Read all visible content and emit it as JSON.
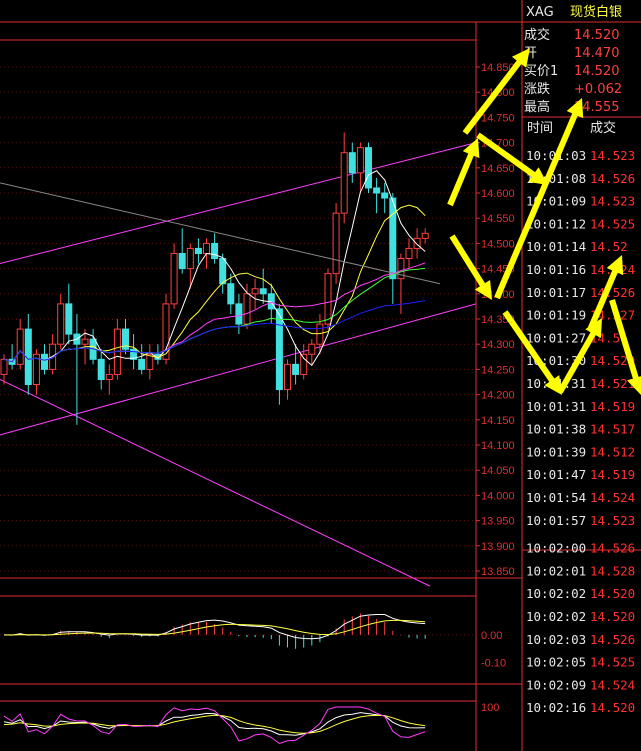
{
  "symbol": "XAG",
  "symbol_name": "现货白银",
  "quote": [
    {
      "label": "成交",
      "value": "14.520"
    },
    {
      "label": "开",
      "value": "14.470"
    },
    {
      "label": "买价1",
      "value": "14.520"
    },
    {
      "label": "涨跌",
      "value": "+0.062"
    },
    {
      "label": "最高",
      "value": "14.555"
    }
  ],
  "ticks_header": {
    "time": "时间",
    "price": "成交"
  },
  "ticks": [
    {
      "time": "10:01:03",
      "price": "14.523"
    },
    {
      "time": "10:01:08",
      "price": "14.526"
    },
    {
      "time": "10:01:09",
      "price": "14.523"
    },
    {
      "time": "10:01:12",
      "price": "14.525"
    },
    {
      "time": "10:01:14",
      "price": "14.52"
    },
    {
      "time": "10:01:16",
      "price": "14.524"
    },
    {
      "time": "10:01:17",
      "price": "14.526"
    },
    {
      "time": "10:01:19",
      "price": "14.527"
    },
    {
      "time": "10:01:27",
      "price": "14.51"
    },
    {
      "time": "10:01:30",
      "price": "14.520"
    },
    {
      "time": "10:01:31",
      "price": "14.521"
    },
    {
      "time": "10:01:31",
      "price": "14.519"
    },
    {
      "time": "10:01:38",
      "price": "14.517"
    },
    {
      "time": "10:01:39",
      "price": "14.512"
    },
    {
      "time": "10:01:47",
      "price": "14.519"
    },
    {
      "time": "10:01:54",
      "price": "14.524"
    },
    {
      "time": "10:01:57",
      "price": "14.523"
    },
    {
      "time": "10:02:00",
      "price": "14.526"
    },
    {
      "time": "10:02:01",
      "price": "14.528"
    },
    {
      "time": "10:02:02",
      "price": "14.520"
    },
    {
      "time": "10:02:02",
      "price": "14.520"
    },
    {
      "time": "10:02:03",
      "price": "14.526"
    },
    {
      "time": "10:02:05",
      "price": "14.525"
    },
    {
      "time": "10:02:09",
      "price": "14.524"
    },
    {
      "time": "10:02:16",
      "price": "14.520"
    }
  ],
  "colors": {
    "up": "#ff4040",
    "down": "#40e0e0",
    "axis": "#e03030",
    "ma1": "#ffffff",
    "ma2": "#ffff40",
    "ma3": "#ff40ff",
    "ma4": "#40ff40",
    "ma5": "#2020ff",
    "channel": "#ff40ff",
    "arrow": "#ffff00"
  },
  "chart_data": [
    {
      "type": "candlestick",
      "ylim": [
        13.84,
        14.88
      ],
      "yticks": [
        "14.850",
        "14.800",
        "14.750",
        "14.700",
        "14.650",
        "14.600",
        "14.550",
        "14.500",
        "14.450",
        "14.400",
        "14.350",
        "14.300",
        "14.250",
        "14.200",
        "14.150",
        "14.100",
        "14.050",
        "14.000",
        "13.950",
        "13.900",
        "13.850"
      ],
      "candles": [
        [
          14.24,
          14.28,
          14.22,
          14.27
        ],
        [
          14.27,
          14.3,
          14.25,
          14.26
        ],
        [
          14.26,
          14.35,
          14.25,
          14.33
        ],
        [
          14.33,
          14.36,
          14.2,
          14.22
        ],
        [
          14.22,
          14.29,
          14.2,
          14.28
        ],
        [
          14.28,
          14.3,
          14.24,
          14.25
        ],
        [
          14.25,
          14.32,
          14.24,
          14.3
        ],
        [
          14.3,
          14.4,
          14.29,
          14.38
        ],
        [
          14.38,
          14.42,
          14.3,
          14.32
        ],
        [
          14.32,
          14.36,
          14.14,
          14.3
        ],
        [
          14.3,
          14.33,
          14.26,
          14.31
        ],
        [
          14.31,
          14.33,
          14.26,
          14.27
        ],
        [
          14.27,
          14.29,
          14.21,
          14.23
        ],
        [
          14.23,
          14.26,
          14.2,
          14.24
        ],
        [
          14.24,
          14.35,
          14.23,
          14.33
        ],
        [
          14.33,
          14.35,
          14.28,
          14.29
        ],
        [
          14.29,
          14.32,
          14.25,
          14.27
        ],
        [
          14.27,
          14.3,
          14.24,
          14.25
        ],
        [
          14.25,
          14.3,
          14.23,
          14.28
        ],
        [
          14.28,
          14.3,
          14.26,
          14.27
        ],
        [
          14.27,
          14.4,
          14.26,
          14.38
        ],
        [
          14.38,
          14.5,
          14.37,
          14.48
        ],
        [
          14.48,
          14.53,
          14.44,
          14.45
        ],
        [
          14.45,
          14.5,
          14.41,
          14.49
        ],
        [
          14.49,
          14.51,
          14.46,
          14.48
        ],
        [
          14.48,
          14.51,
          14.45,
          14.5
        ],
        [
          14.5,
          14.52,
          14.46,
          14.47
        ],
        [
          14.47,
          14.48,
          14.4,
          14.42
        ],
        [
          14.42,
          14.44,
          14.36,
          14.38
        ],
        [
          14.38,
          14.4,
          14.32,
          14.34
        ],
        [
          14.34,
          14.42,
          14.33,
          14.4
        ],
        [
          14.4,
          14.43,
          14.37,
          14.41
        ],
        [
          14.41,
          14.45,
          14.38,
          14.4
        ],
        [
          14.4,
          14.42,
          14.34,
          14.37
        ],
        [
          14.37,
          14.38,
          14.18,
          14.21
        ],
        [
          14.21,
          14.27,
          14.19,
          14.26
        ],
        [
          14.26,
          14.3,
          14.22,
          14.24
        ],
        [
          14.24,
          14.3,
          14.23,
          14.28
        ],
        [
          14.28,
          14.31,
          14.26,
          14.3
        ],
        [
          14.3,
          14.36,
          14.28,
          14.34
        ],
        [
          14.34,
          14.45,
          14.33,
          14.44
        ],
        [
          14.44,
          14.58,
          14.42,
          14.56
        ],
        [
          14.56,
          14.72,
          14.54,
          14.68
        ],
        [
          14.68,
          14.7,
          14.62,
          14.64
        ],
        [
          14.64,
          14.7,
          14.6,
          14.69
        ],
        [
          14.69,
          14.7,
          14.6,
          14.61
        ],
        [
          14.61,
          14.63,
          14.56,
          14.6
        ],
        [
          14.6,
          14.62,
          14.56,
          14.59
        ],
        [
          14.59,
          14.6,
          14.38,
          14.43
        ],
        [
          14.43,
          14.48,
          14.36,
          14.47
        ],
        [
          14.47,
          14.51,
          14.45,
          14.49
        ],
        [
          14.49,
          14.53,
          14.47,
          14.51
        ],
        [
          14.51,
          14.53,
          14.5,
          14.52
        ]
      ]
    },
    {
      "type": "bar",
      "panel": "MACD",
      "yticks": [
        "0.00",
        "-0.10"
      ],
      "ylim": [
        -0.15,
        0.12
      ]
    },
    {
      "type": "line",
      "panel": "KDJ",
      "yticks": [
        "100"
      ]
    }
  ]
}
